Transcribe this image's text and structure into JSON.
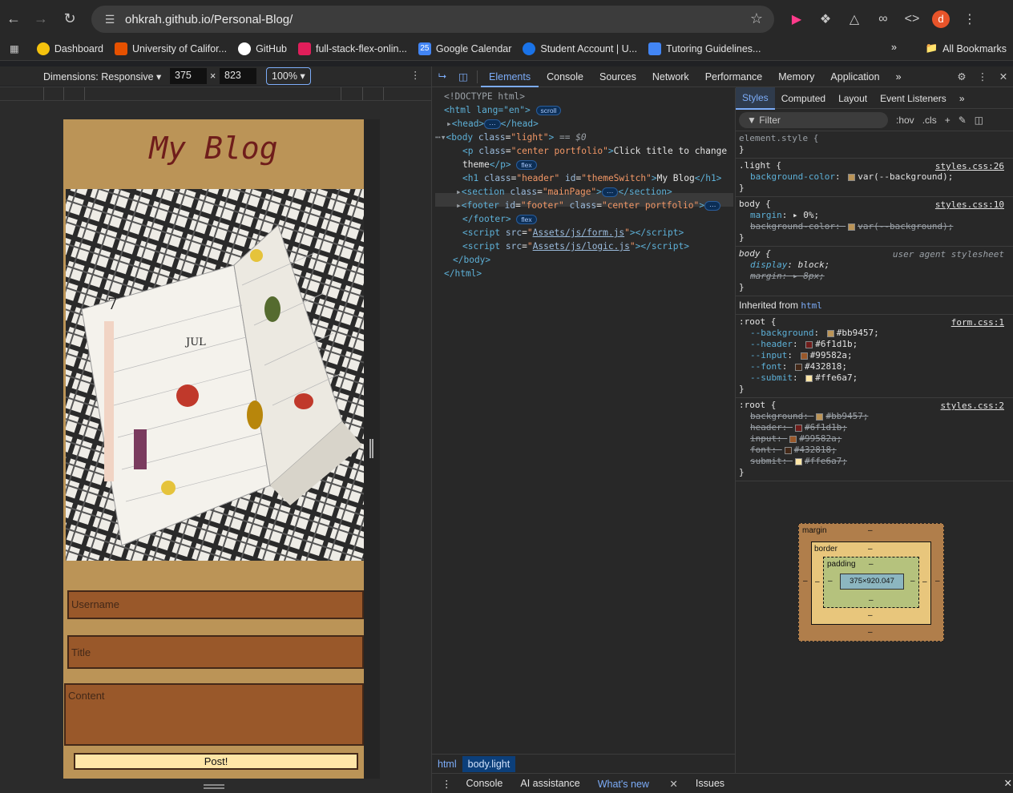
{
  "browser": {
    "url": "ohkrah.github.io/Personal-Blog/",
    "avatar_letter": "d",
    "bookmarks": [
      {
        "label": "Dashboard",
        "color": "#f4c20d"
      },
      {
        "label": "University of Califor...",
        "color": "#e65100"
      },
      {
        "label": "GitHub",
        "color": "#ffffff"
      },
      {
        "label": "full-stack-flex-onlin...",
        "color": "#e01e5a"
      },
      {
        "label": "Google Calendar",
        "color": "#4285f4"
      },
      {
        "label": "Student Account | U...",
        "color": "#1a73e8"
      },
      {
        "label": "Tutoring Guidelines...",
        "color": "#4285f4"
      }
    ],
    "all_bookmarks": "All Bookmarks",
    "more": "»"
  },
  "device_toolbar": {
    "dimensions_label": "Dimensions: Responsive",
    "width": "375",
    "times": "×",
    "height": "823",
    "zoom": "100%"
  },
  "page": {
    "title": "My Blog",
    "username_placeholder": "Username",
    "title_placeholder": "Title",
    "content_placeholder": "Content",
    "post_button": "Post!",
    "colors": {
      "background": "#bb9457",
      "header": "#6f1d1b",
      "input": "#99582a",
      "font": "#432818",
      "submit": "#ffe6a7"
    }
  },
  "devtools": {
    "tabs": [
      "Elements",
      "Console",
      "Sources",
      "Network",
      "Performance",
      "Memory",
      "Application"
    ],
    "active_tab": "Elements",
    "dom": {
      "doctype": "<!DOCTYPE html>",
      "html_open": "<html lang=\"en\">",
      "scroll_badge": "scroll",
      "head": "<head>",
      "head_close": "</head>",
      "body_attr_value": "\"light\"",
      "body_eq": " == $0",
      "p_text1": "Click title to change",
      "p_text2": "theme",
      "flex_badge": "flex",
      "h1_text": "My Blog",
      "section_class": "\"mainPage\"",
      "footer_id": "\"footer\"",
      "footer_class": "\"center portfolio\"",
      "p_class": "\"center portfolio\"",
      "h1_class": "\"header\"",
      "h1_id": "\"themeSwitch\"",
      "script1": "Assets/js/form.js",
      "script2": "Assets/js/logic.js",
      "body_close": "</body>",
      "html_close": "</html>",
      "footer_close": "</footer>"
    },
    "breadcrumbs": [
      "html",
      "body.light"
    ],
    "drawer_tabs": [
      "Console",
      "AI assistance",
      "What's new",
      "Issues"
    ],
    "styles": {
      "tabs": [
        "Styles",
        "Computed",
        "Layout",
        "Event Listeners"
      ],
      "filter_placeholder": "Filter",
      "hov": ":hov",
      "cls": ".cls",
      "element_style": "element.style {",
      "rules": [
        {
          "selector": ".light {",
          "source": "styles.css:26",
          "props": [
            {
              "name": "background-color",
              "value": "var(--background);",
              "swatch": "#bb9457",
              "struck": false
            }
          ]
        },
        {
          "selector": "body {",
          "source": "styles.css:10",
          "props": [
            {
              "name": "margin",
              "value": "0%;",
              "swatch": "",
              "struck": false
            },
            {
              "name": "background-color",
              "value": "var(--background);",
              "swatch": "#bb9457",
              "struck": true
            }
          ]
        },
        {
          "selector": "body {",
          "source": "user agent stylesheet",
          "props": [
            {
              "name": "display",
              "value": "block;",
              "swatch": "",
              "struck": false
            },
            {
              "name": "margin",
              "value": "8px;",
              "swatch": "",
              "struck": true
            }
          ]
        }
      ],
      "inherited_label": "Inherited from",
      "inherited_tag": "html",
      "root_rules": [
        {
          "selector": ":root {",
          "source": "form.css:1",
          "struck": false,
          "vars": [
            {
              "name": "--background",
              "value": "#bb9457;"
            },
            {
              "name": "--header",
              "value": "#6f1d1b;"
            },
            {
              "name": "--input",
              "value": "#99582a;"
            },
            {
              "name": "--font",
              "value": "#432818;"
            },
            {
              "name": "--submit",
              "value": "#ffe6a7;"
            }
          ]
        },
        {
          "selector": ":root {",
          "source": "styles.css:2",
          "struck": true,
          "vars": [
            {
              "name": "background",
              "value": "#bb9457;"
            },
            {
              "name": "header",
              "value": "#6f1d1b;"
            },
            {
              "name": "input",
              "value": "#99582a;"
            },
            {
              "name": "font",
              "value": "#432818;"
            },
            {
              "name": "submit",
              "value": "#ffe6a7;"
            }
          ]
        }
      ],
      "box_model": {
        "margin": "margin",
        "border": "border",
        "padding": "padding",
        "content": "375×920.047",
        "dash": "–"
      }
    }
  }
}
